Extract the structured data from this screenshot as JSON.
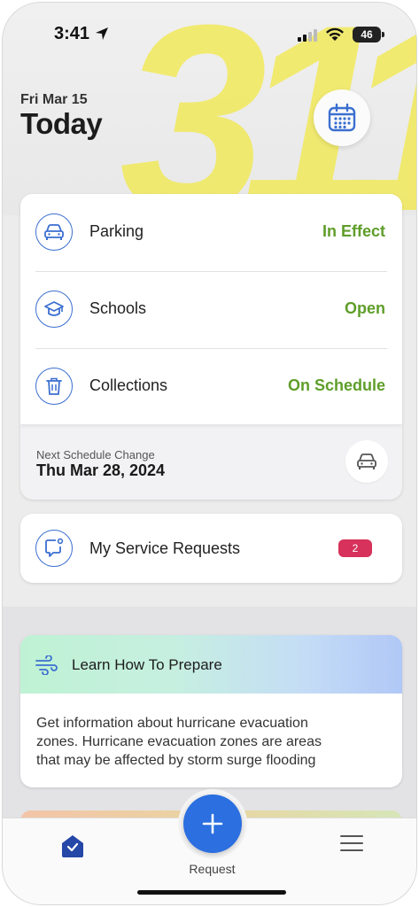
{
  "status_bar": {
    "time": "3:41",
    "battery": "46"
  },
  "header": {
    "date": "Fri Mar 15",
    "title": "Today",
    "brand": "311"
  },
  "status_list": [
    {
      "label": "Parking",
      "value": "In Effect",
      "icon": "car-icon"
    },
    {
      "label": "Schools",
      "value": "Open",
      "icon": "graduation-cap-icon"
    },
    {
      "label": "Collections",
      "value": "On Schedule",
      "icon": "trash-icon"
    }
  ],
  "next_change": {
    "label": "Next Schedule Change",
    "date": "Thu Mar 28, 2024"
  },
  "service_requests": {
    "label": "My Service Requests",
    "count": "2"
  },
  "prepare": {
    "title": "Learn How To Prepare",
    "lines": [
      "Get information about hurricane evacuation",
      "zones. Hurricane evacuation zones are areas",
      "that may be affected by storm surge flooding"
    ]
  },
  "tabbar": {
    "request_label": "Request"
  },
  "colors": {
    "accent": "#2b6fe0",
    "status_green": "#5f9e2a",
    "badge_red": "#d6325b",
    "brand_yellow": "#f1e95a"
  }
}
